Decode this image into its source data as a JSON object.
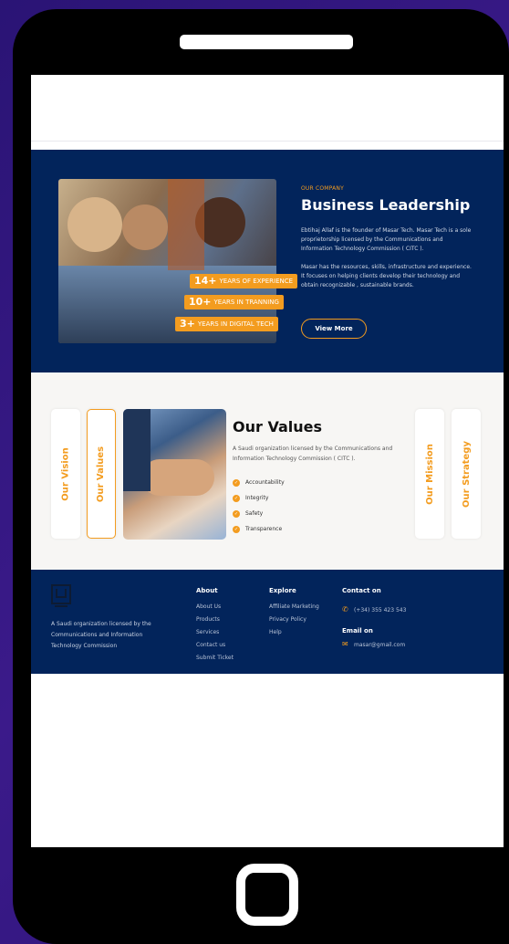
{
  "company": {
    "eyebrow": "OUR COMPANY",
    "title": "Business Leadership",
    "para1": "Ebtihaj Allaf is the founder of Masar Tech. Masar Tech is a sole proprietorship licensed by the Communications and Information Technology Commission ( CITC ).",
    "para2": "Masar has the resources, skills, infrastructure and experience. It focuses on helping clients develop their technology and obtain recognizable , sustainable brands.",
    "button": "View More",
    "badges": [
      {
        "num": "14+",
        "label": "YEARS OF EXPERIENCE"
      },
      {
        "num": "10+",
        "label": "YEARS IN TRANNING"
      },
      {
        "num": "3+",
        "label": "YEARS IN DIGITAL TECH"
      }
    ]
  },
  "values": {
    "tabs": [
      "Our Vision",
      "Our Values",
      "Our Mission",
      "Our Strategy"
    ],
    "title": "Our Values",
    "desc": "A Saudi organization licensed by the Communications and Information Technology Commission ( CITC ).",
    "items": [
      "Accountability",
      "Integrity",
      "Safety",
      "Transparence"
    ]
  },
  "footer": {
    "about_text": "A Saudi organization licensed by the Communications and Information Technology Commission",
    "about_heading": "About",
    "about_links": [
      "About Us",
      "Products",
      "Services",
      "Contact us",
      "Submit Ticket"
    ],
    "explore_heading": "Explore",
    "explore_links": [
      "Affiliate Marketing",
      "Privacy Policy",
      "Help"
    ],
    "contact_heading": "Contact on",
    "phone": "(+34) 355 423 543",
    "email_heading": "Email on",
    "email": "masar@gmail.com"
  },
  "colors": {
    "navy": "#02245b",
    "orange": "#f39c1f",
    "purple_bg": "#3b1a8a"
  }
}
